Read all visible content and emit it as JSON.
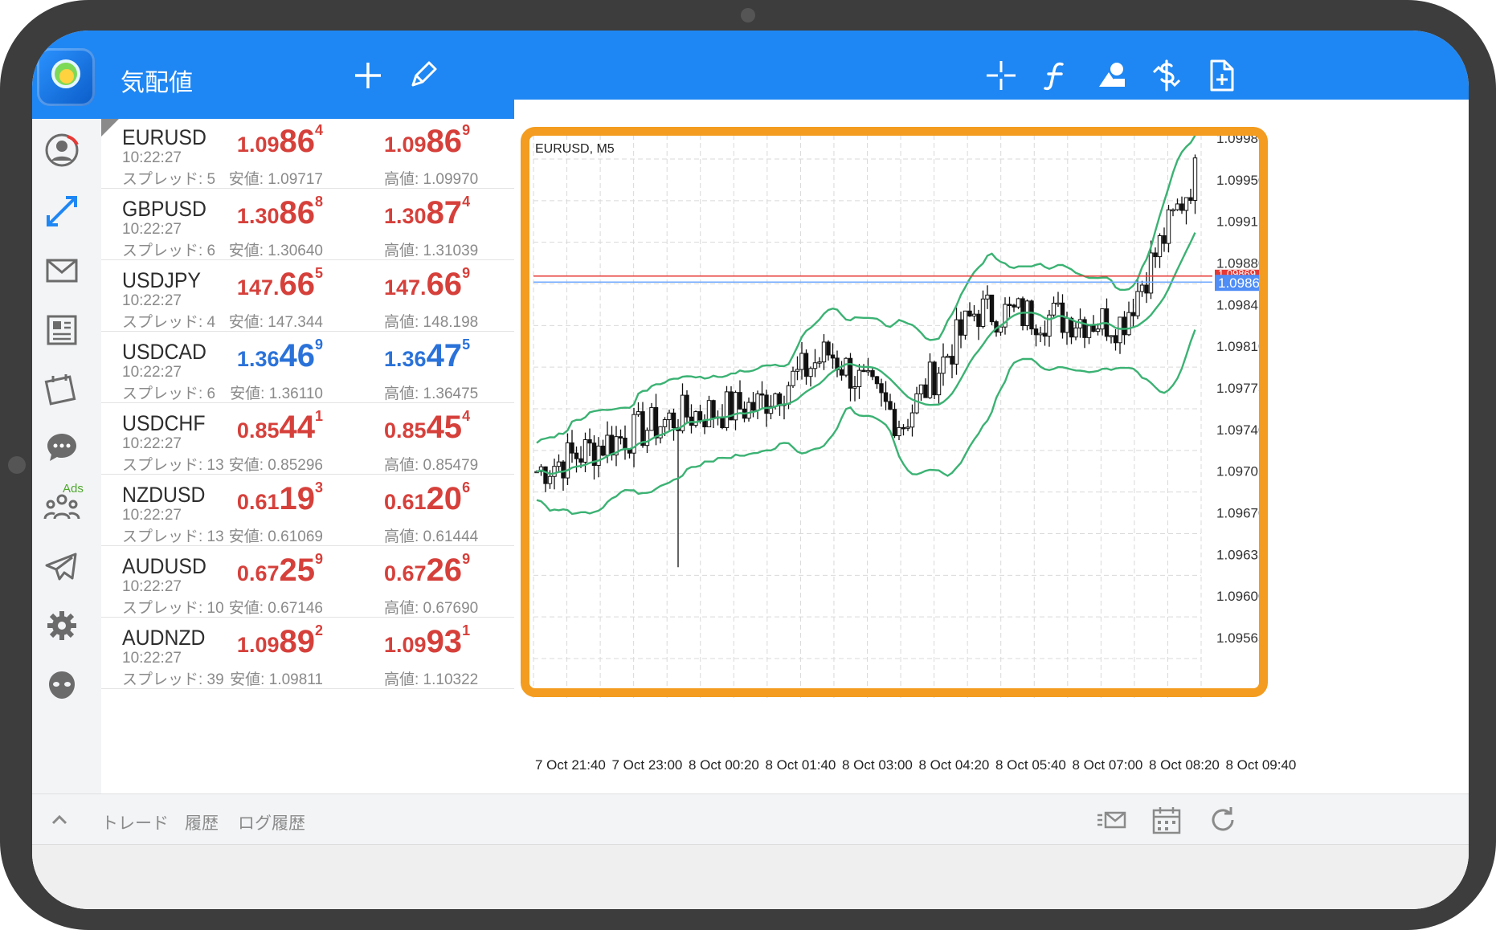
{
  "header": {
    "title": "気配値",
    "icons": [
      "app-logo-icon",
      "plus-icon",
      "pencil-icon",
      "crosshair-icon",
      "indicator-f-icon",
      "objects-icon",
      "trade-dollar-icon",
      "new-document-icon"
    ]
  },
  "sidebar": {
    "items": [
      "account-icon",
      "quotes-arrows-icon",
      "mail-icon",
      "news-icon",
      "ads-calendar-icon",
      "chat-icon",
      "community-icon",
      "telegram-icon",
      "settings-icon",
      "alien-icon"
    ],
    "ads_label": "Ads"
  },
  "quotes": [
    {
      "symbol": "EURUSD",
      "time": "10:22:27",
      "spread": "スプレッド: 5",
      "bid_a": "1.09",
      "bid_b": "86",
      "bid_c": "4",
      "ask_a": "1.09",
      "ask_b": "86",
      "ask_c": "9",
      "low": "安値: 1.09717",
      "high": "高値: 1.09970",
      "color": "red"
    },
    {
      "symbol": "GBPUSD",
      "time": "10:22:27",
      "spread": "スプレッド: 6",
      "bid_a": "1.30",
      "bid_b": "86",
      "bid_c": "8",
      "ask_a": "1.30",
      "ask_b": "87",
      "ask_c": "4",
      "low": "安値: 1.30640",
      "high": "高値: 1.31039",
      "color": "red"
    },
    {
      "symbol": "USDJPY",
      "time": "10:22:27",
      "spread": "スプレッド: 4",
      "bid_a": "147.",
      "bid_b": "66",
      "bid_c": "5",
      "ask_a": "147.",
      "ask_b": "66",
      "ask_c": "9",
      "low": "安値: 147.344",
      "high": "高値: 148.198",
      "color": "red"
    },
    {
      "symbol": "USDCAD",
      "time": "10:22:27",
      "spread": "スプレッド: 6",
      "bid_a": "1.36",
      "bid_b": "46",
      "bid_c": "9",
      "ask_a": "1.36",
      "ask_b": "47",
      "ask_c": "5",
      "low": "安値: 1.36110",
      "high": "高値: 1.36475",
      "color": "blue"
    },
    {
      "symbol": "USDCHF",
      "time": "10:22:27",
      "spread": "スプレッド: 13",
      "bid_a": "0.85",
      "bid_b": "44",
      "bid_c": "1",
      "ask_a": "0.85",
      "ask_b": "45",
      "ask_c": "4",
      "low": "安値: 0.85296",
      "high": "高値: 0.85479",
      "color": "red"
    },
    {
      "symbol": "NZDUSD",
      "time": "10:22:27",
      "spread": "スプレッド: 13",
      "bid_a": "0.61",
      "bid_b": "19",
      "bid_c": "3",
      "ask_a": "0.61",
      "ask_b": "20",
      "ask_c": "6",
      "low": "安値: 0.61069",
      "high": "高値: 0.61444",
      "color": "red"
    },
    {
      "symbol": "AUDUSD",
      "time": "10:22:27",
      "spread": "スプレッド: 10",
      "bid_a": "0.67",
      "bid_b": "25",
      "bid_c": "9",
      "ask_a": "0.67",
      "ask_b": "26",
      "ask_c": "9",
      "low": "安値: 0.67146",
      "high": "高値: 0.67690",
      "color": "red"
    },
    {
      "symbol": "AUDNZD",
      "time": "10:22:27",
      "spread": "スプレッド: 39",
      "bid_a": "1.09",
      "bid_b": "89",
      "bid_c": "2",
      "ask_a": "1.09",
      "ask_b": "93",
      "ask_c": "1",
      "low": "安値: 1.09811",
      "high": "高値: 1.10322",
      "color": "red"
    }
  ],
  "chart": {
    "label": "EURUSD, M5",
    "price_labels": [
      "1.09985",
      "1.09950",
      "1.09915",
      "1.09880",
      "1.09845",
      "1.09810",
      "1.09775",
      "1.09740",
      "1.09705",
      "1.09670",
      "1.09635",
      "1.09600",
      "1.09565"
    ],
    "current_bid_label": "1.09864",
    "ask_label_partial": "1.09869",
    "time_labels": [
      "7 Oct 21:40",
      "7 Oct 23:00",
      "8 Oct 00:20",
      "8 Oct 01:40",
      "8 Oct 03:00",
      "8 Oct 04:20",
      "8 Oct 05:40",
      "8 Oct 07:00",
      "8 Oct 08:20",
      "8 Oct 09:40"
    ],
    "colors": {
      "band": "#3bb273",
      "ask_line": "#e53935",
      "bid_line": "#6fa8ff",
      "highlight": "#f39c1f"
    }
  },
  "chart_data": {
    "type": "candlestick",
    "title": "EURUSD, M5",
    "xlabel": "",
    "ylabel": "",
    "ylim": [
      1.0954,
      1.1
    ],
    "x": [
      "7 Oct 21:40",
      "7 Oct 23:00",
      "8 Oct 00:20",
      "8 Oct 01:40",
      "8 Oct 03:00",
      "8 Oct 04:20",
      "8 Oct 05:40",
      "8 Oct 07:00",
      "8 Oct 08:20",
      "8 Oct 09:40"
    ],
    "close": [
      1.09705,
      1.0973,
      1.09752,
      1.0976,
      1.09805,
      1.09745,
      1.0984,
      1.09835,
      1.0983,
      1.09955
    ],
    "bid_line": 1.09864,
    "ask_line": 1.09869
  },
  "bottom": {
    "tabs": [
      "トレード",
      "履歴",
      "ログ履歴"
    ],
    "icons": [
      "chevron-up-icon",
      "mail-list-icon",
      "calendar-icon",
      "refresh-icon"
    ]
  }
}
